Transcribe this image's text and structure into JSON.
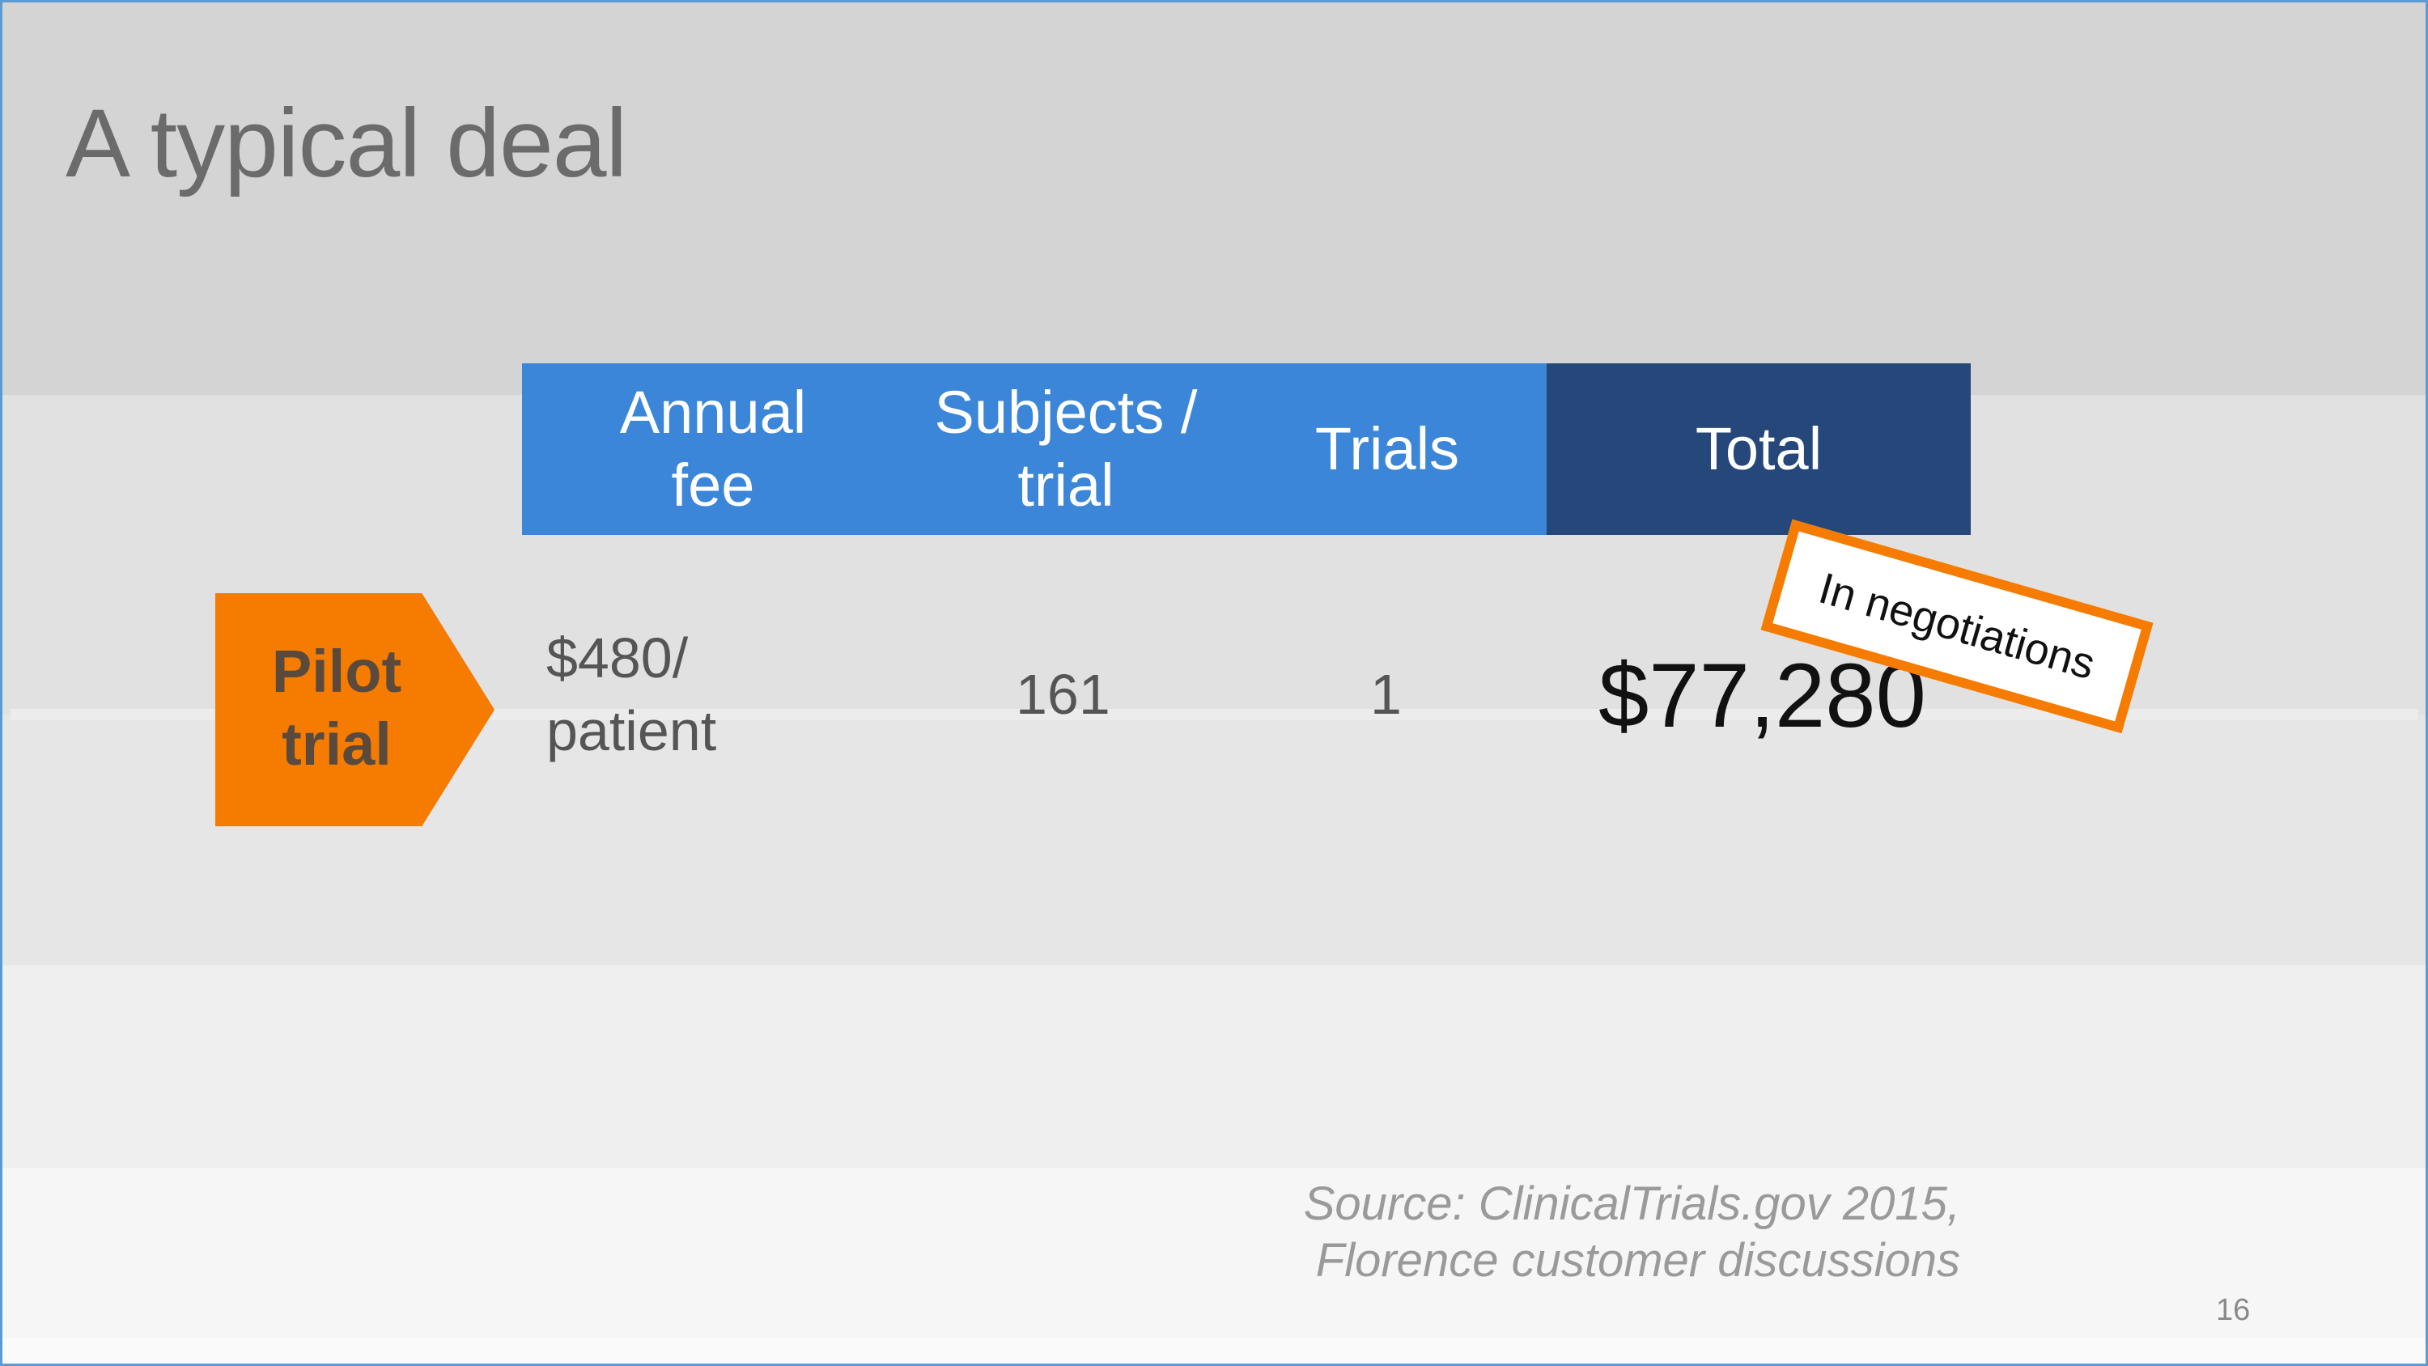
{
  "slide": {
    "title": "A typical deal",
    "page_number": "16"
  },
  "table": {
    "headers": {
      "annual_fee": [
        "Annual",
        "fee"
      ],
      "subjects_per_trial": [
        "Subjects /",
        "trial"
      ],
      "trials": "Trials",
      "total": "Total"
    },
    "row": {
      "label": [
        "Pilot",
        "trial"
      ],
      "annual_fee": [
        "$480/",
        "patient"
      ],
      "subjects_per_trial": "161",
      "trials": "1",
      "total": "$77,280"
    }
  },
  "stamp": {
    "text": "In negotiations"
  },
  "source": {
    "lines": [
      "Source: ClinicalTrials.gov 2015,",
      "Florence customer discussions"
    ]
  },
  "colors": {
    "header_blue": "#3b86d8",
    "header_dark": "#254779",
    "accent_orange": "#f57c00",
    "frame_blue": "#5b9bd5"
  }
}
